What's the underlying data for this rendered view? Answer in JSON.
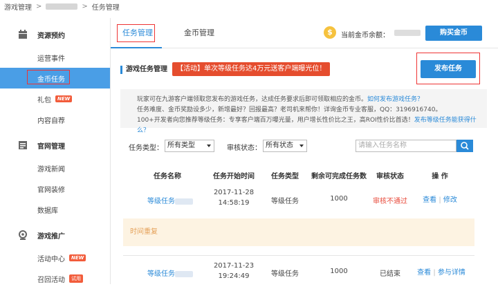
{
  "breadcrumb": {
    "root": "游戏管理",
    "sep": ">",
    "sep2": ">",
    "current": "任务管理"
  },
  "sidebar": {
    "sections": [
      {
        "label": "资源预约",
        "icon": "calendar-icon"
      },
      {
        "label": "官网管理",
        "icon": "website-icon"
      },
      {
        "label": "游戏推广",
        "icon": "promotion-icon"
      }
    ],
    "items": [
      {
        "label": "运营事件"
      },
      {
        "label": "金币任务"
      },
      {
        "label": "礼包",
        "badge": "NEW"
      },
      {
        "label": "内容自荐"
      },
      {
        "label": "游戏新闻"
      },
      {
        "label": "官网装修"
      },
      {
        "label": "数据库"
      },
      {
        "label": "活动中心",
        "badge": "NEW"
      },
      {
        "label": "召回活动",
        "badge": "试用"
      }
    ]
  },
  "tabs": [
    {
      "label": "任务管理"
    },
    {
      "label": "金币管理"
    }
  ],
  "header": {
    "coin_symbol": "$",
    "balance_label": "当前金币余额：",
    "buy_label": "购买金币"
  },
  "section_title": "游戏任务管理",
  "promo_text": "【活动】单次等级任务达4万元送客户端曝光位！",
  "promo_arrow": "↗",
  "publish_label": "发布任务",
  "info": {
    "line1": "玩家可在九游客户端领取您发布的游戏任务，达成任务要求后即可领取相应的金币。",
    "line1_link": "如何发布游戏任务？",
    "line2": "任务难度、金币奖励设多少，新增最好？回报最高？老司机来帮你！详询金币专业客服，QQ：3196916740。",
    "line3": "100+开发者向您推荐等级任务：专享客户端百万曝光量，用户增长性价比之王，高ROI性价比首选！",
    "line3_link": "发布等级任务能获得什么？"
  },
  "filters": {
    "type_label": "任务类型：",
    "type_value": "所有类型",
    "status_label": "审核状态：",
    "status_value": "所有状态",
    "search_placeholder": "请输入任务名称"
  },
  "table": {
    "headers": [
      "任务名称",
      "任务开始时间",
      "任务类型",
      "剩余可完成任务数",
      "审核状态",
      "操 作"
    ],
    "rows": [
      {
        "name": "等级任务",
        "date": "2017-11-28",
        "time": "14:58:19",
        "type": "等级任务",
        "remaining": "1000",
        "status": "审核不通过",
        "action1": "查看",
        "action_sep": "|",
        "action2": "修改"
      },
      {
        "name": "等级任务",
        "date": "2017-11-23",
        "time": "19:24:49",
        "type": "等级任务",
        "remaining": "1000",
        "status": "已结束",
        "action1": "查看",
        "action_sep": "|",
        "action2": "参与详情"
      }
    ],
    "note": "时间重复"
  },
  "colors": {
    "accent": "#2a8ad8",
    "sidebar_active": "#4a9ee6",
    "promo": "#e54d2e",
    "highlight_box": "#e33333",
    "reject": "#e84c3d",
    "note_bg": "#fdf3e2",
    "note_text": "#e5a25a",
    "coin": "#f6c23e"
  }
}
